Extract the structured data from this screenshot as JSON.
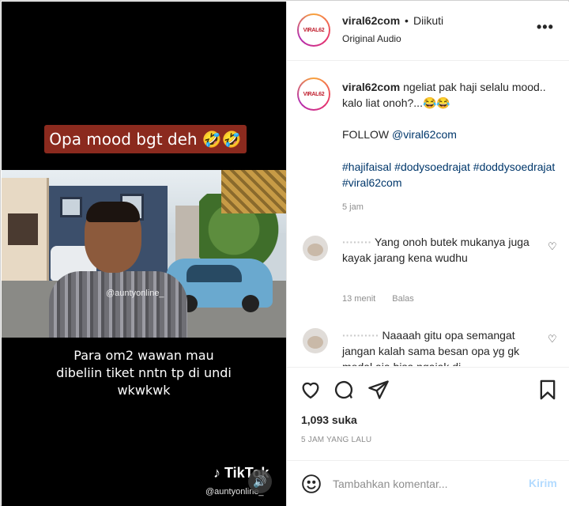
{
  "video": {
    "caption_top": "Opa mood bgt deh 🤣🤣",
    "caption_bottom": "Para om2 wawan mau dibeliin tiket nntn tp di undi wkwkwk",
    "watermark_mid": "@auntyonline_",
    "tiktok_logo": "TikTok",
    "tiktok_user": "@auntyonline_",
    "sound_icon": "speaker-icon"
  },
  "header": {
    "avatar_logo": "VIRAL62",
    "username": "viral62com",
    "dot": "•",
    "follow_status": "Diikuti",
    "audio": "Original Audio",
    "more_icon": "more-horizontal-icon"
  },
  "caption": {
    "username": "viral62com",
    "text": "ngeliat pak haji selalu mood.. kalo liat onoh?...😂😂",
    "follow_label": "FOLLOW",
    "follow_mention": "@viral62com",
    "hashtags": "#hajifaisal #dodysoedrajat #doddysoedrajat #viral62com",
    "time": "5 jam"
  },
  "comments": [
    {
      "username": "········",
      "text": "Yang onoh butek mukanya juga kayak jarang kena wudhu",
      "time": "13 menit",
      "reply": "Balas"
    },
    {
      "username": "··········",
      "text": "Naaaah gitu opa semangat jangan kalah sama besan opa yg gk modal aja bisa ngajak di"
    }
  ],
  "actions": {
    "icons": [
      "heart-icon",
      "comment-icon",
      "share-icon",
      "bookmark-icon"
    ],
    "likes": "1,093 suka",
    "posted": "5 JAM YANG LALU"
  },
  "add_comment": {
    "placeholder": "Tambahkan komentar...",
    "post_label": "Kirim"
  },
  "colors": {
    "caption_bg": "#8b2a1e",
    "link": "#00376b",
    "post_disabled": "#b3dbff",
    "brand_red": "#c0202f"
  }
}
